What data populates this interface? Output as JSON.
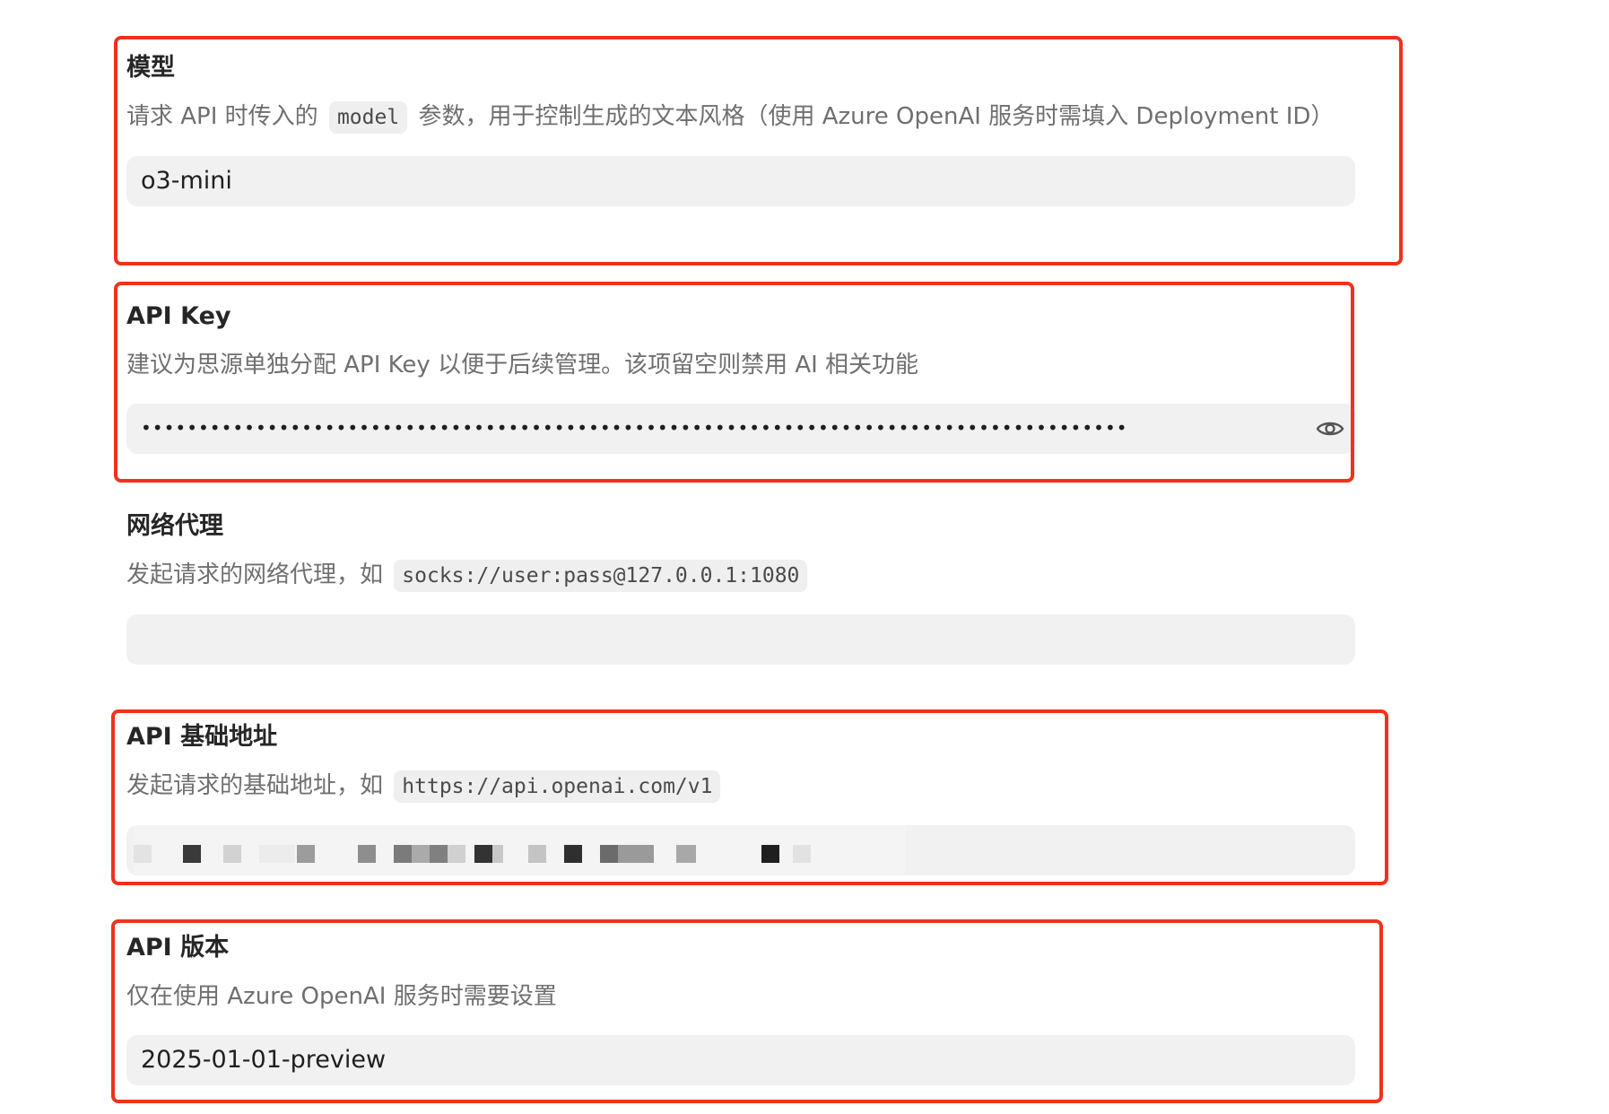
{
  "model": {
    "title": "模型",
    "desc_before": "请求 API 时传入的",
    "desc_code": "model",
    "desc_after": "参数，用于控制生成的文本风格（使用 Azure OpenAI 服务时需填入 Deployment ID）",
    "value": "o3-mini"
  },
  "api_key": {
    "title": "API Key",
    "desc": "建议为思源单独分配 API Key 以便于后续管理。该项留空则禁用 AI 相关功能",
    "masked_value": "••••••••••••••••••••••••••••••••••••••••••••••••••••••••••••••••••••••••••••••••••••••",
    "eye_icon": "eye-icon"
  },
  "proxy": {
    "title": "网络代理",
    "desc_before": "发起请求的网络代理，如",
    "desc_code": "socks://user:pass@127.0.0.1:1080",
    "value": ""
  },
  "base_url": {
    "title": "API 基础地址",
    "desc_before": "发起请求的基础地址，如",
    "desc_code": "https://api.openai.com/v1"
  },
  "api_version": {
    "title": "API 版本",
    "desc": "仅在使用 Azure OpenAI 服务时需要设置",
    "value": "2025-01-01-preview"
  },
  "colors": {
    "highlight_border": "#f2311c",
    "field_background": "#f1f1f1",
    "description_text": "#6f6f6f"
  }
}
